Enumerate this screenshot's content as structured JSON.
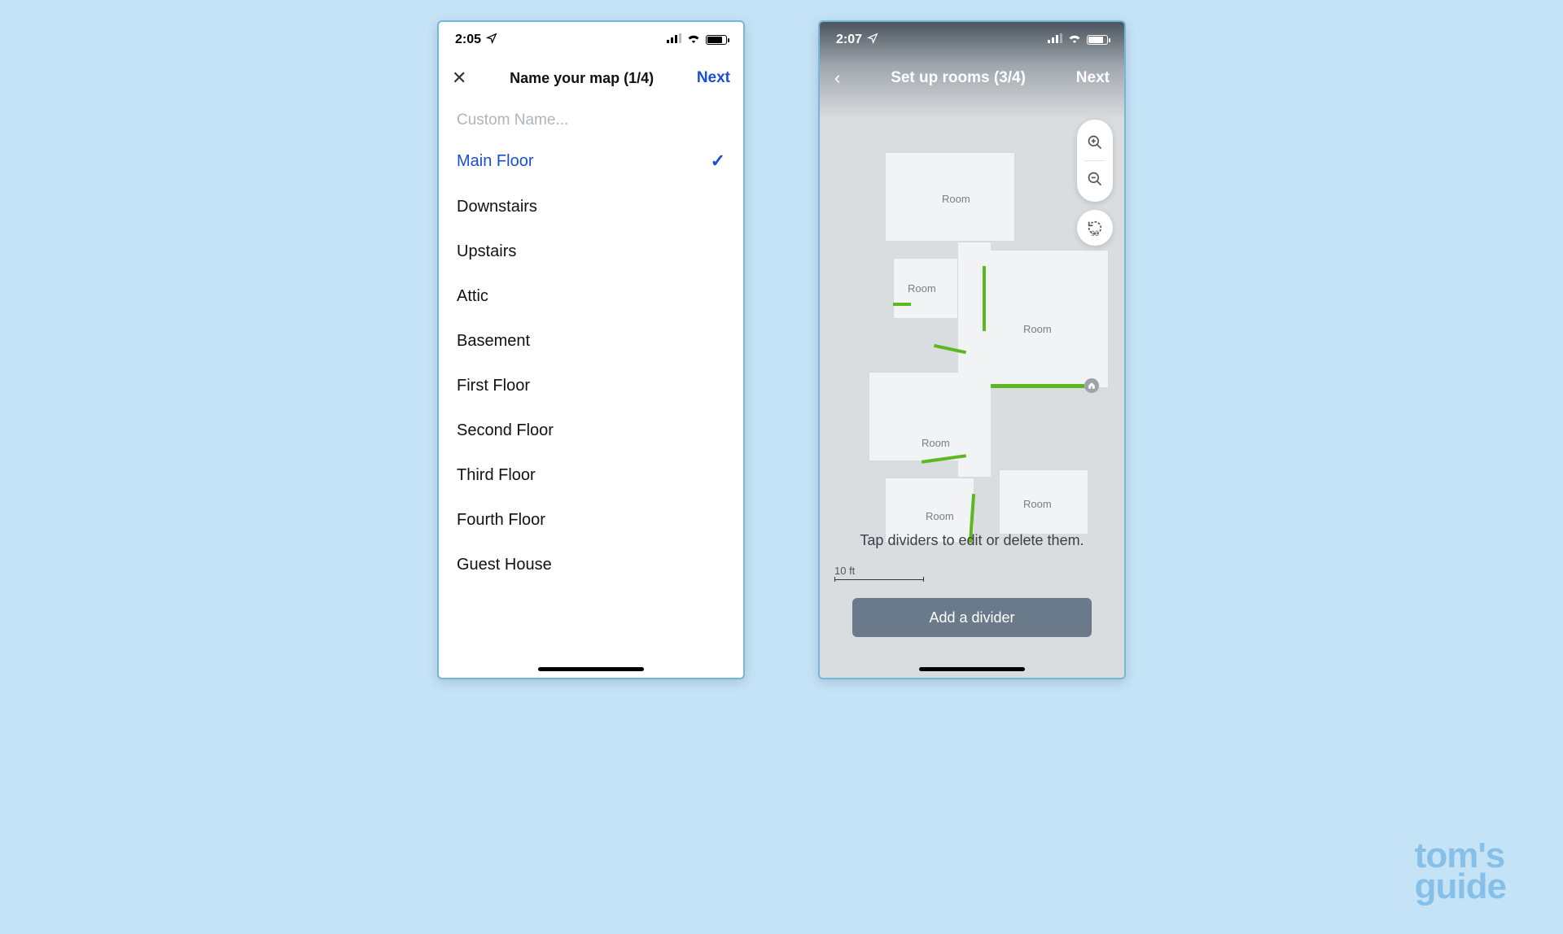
{
  "watermark": {
    "line1": "tom's",
    "line2": "guide"
  },
  "phone1": {
    "status": {
      "time": "2:05",
      "loc_icon": "location-arrow"
    },
    "nav": {
      "close": "✕",
      "title": "Name your map (1/4)",
      "next": "Next"
    },
    "custom_placeholder": "Custom Name...",
    "options": [
      {
        "label": "Main Floor",
        "selected": true
      },
      {
        "label": "Downstairs",
        "selected": false
      },
      {
        "label": "Upstairs",
        "selected": false
      },
      {
        "label": "Attic",
        "selected": false
      },
      {
        "label": "Basement",
        "selected": false
      },
      {
        "label": "First Floor",
        "selected": false
      },
      {
        "label": "Second Floor",
        "selected": false
      },
      {
        "label": "Third Floor",
        "selected": false
      },
      {
        "label": "Fourth Floor",
        "selected": false
      },
      {
        "label": "Guest House",
        "selected": false
      }
    ]
  },
  "phone2": {
    "status": {
      "time": "2:07",
      "loc_icon": "location-arrow"
    },
    "nav": {
      "back": "‹",
      "title": "Set up rooms (3/4)",
      "next": "Next"
    },
    "controls": {
      "zoom_in": "zoom-in",
      "zoom_out": "zoom-out",
      "rotate": "90"
    },
    "rooms": [
      "Room",
      "Room",
      "Room",
      "Room",
      "Room",
      "Room"
    ],
    "hint": "Tap dividers to edit or delete them.",
    "scale": "10 ft",
    "add_divider": "Add a divider",
    "home_icon": "home"
  }
}
